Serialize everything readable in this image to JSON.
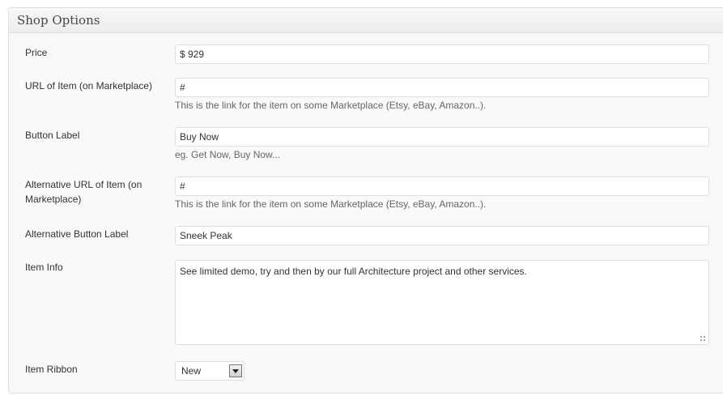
{
  "panel": {
    "title": "Shop Options"
  },
  "fields": {
    "price": {
      "label": "Price",
      "value": "$ 929"
    },
    "url": {
      "label": "URL of Item (on Marketplace)",
      "value": "#",
      "hint": "This is the link for the item on some Marketplace (Etsy, eBay, Amazon..)."
    },
    "button_label": {
      "label": "Button Label",
      "value": "Buy Now",
      "hint": "eg. Get Now, Buy Now..."
    },
    "alt_url": {
      "label_line1": "Alternative URL of Item (on",
      "label_line2": "Marketplace)",
      "value": "#",
      "hint": "This is the link for the item on some Marketplace (Etsy, eBay, Amazon..)."
    },
    "alt_button_label": {
      "label": "Alternative Button Label",
      "value": "Sneek Peak"
    },
    "item_info": {
      "label": "Item Info",
      "value": "See limited demo, try and then by our full Architecture project and other services."
    },
    "item_ribbon": {
      "label": "Item Ribbon",
      "value": "New"
    }
  },
  "icons": {
    "select_arrow": "chevron-down-icon",
    "resize": "resize-grip-icon"
  }
}
